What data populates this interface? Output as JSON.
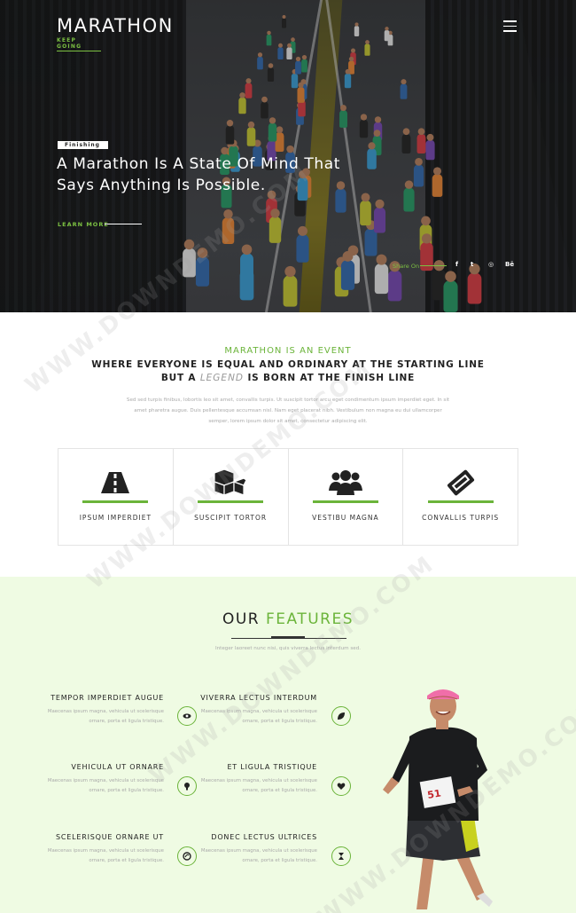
{
  "hero": {
    "brand": "MARATHON",
    "tagline": "KEEP GOING",
    "badge": "Finishing",
    "headline": "A Marathon Is A State Of Mind That Says Anything Is Possible.",
    "learn_more": "LEARN MORE",
    "share_label": "Share On",
    "social": [
      {
        "name": "facebook-icon",
        "glyph": "f"
      },
      {
        "name": "twitter-icon",
        "glyph": "t"
      },
      {
        "name": "dribbble-icon",
        "glyph": "◎"
      },
      {
        "name": "behance-icon",
        "glyph": "Bē"
      }
    ]
  },
  "event": {
    "kicker": "MARATHON IS AN EVENT",
    "title_line1": "WHERE EVERYONE IS EQUAL AND ORDINARY AT THE STARTING LINE",
    "title_line2_pre": "BUT A ",
    "title_line2_em": "LEGEND",
    "title_line2_post": " IS BORN AT THE FINISH LINE",
    "copy": "Sed sed turpis finibus, lobortis leo sit amet, convallis turpis. Ut suscipit tortor arcu eget condimentum ipsum imperdiet eget. In sit amet pharetra augue. Duis pellentesque accumsan nisl. Nam eget placerat nibh. Vestibulum non magna eu dui ullamcorper semper, lorem ipsum dolor sit amet, consectetur adipiscing elit.",
    "cards": [
      {
        "label": "IPSUM IMPERDIET",
        "icon": "road-icon"
      },
      {
        "label": "SUSCIPIT TORTOR",
        "icon": "cubes-icon"
      },
      {
        "label": "VESTIBU MAGNA",
        "icon": "users-icon"
      },
      {
        "label": "CONVALLIS TURPIS",
        "icon": "ticket-icon"
      }
    ]
  },
  "features": {
    "title_plain": "OUR ",
    "title_highlight": "FEATURES",
    "subtitle": "Integer laoreet nunc nisi, quis viverra lectus interdum sed.",
    "items_left": [
      {
        "title": "TEMPOR IMPERDIET AUGUE",
        "desc": "Maecenas ipsum magna, vehicula ut scelerisque ornare, porta et ligula tristique."
      },
      {
        "title": "VEHICULA UT ORNARE",
        "desc": "Maecenas ipsum magna, vehicula ut scelerisque ornare, porta et ligula tristique."
      },
      {
        "title": "SCELERISQUE ORNARE UT",
        "desc": "Maecenas ipsum magna, vehicula ut scelerisque ornare, porta et ligula tristique."
      }
    ],
    "items_right": [
      {
        "title": "VIVERRA LECTUS INTERDUM",
        "desc": "Maecenas ipsum magna, vehicula ut scelerisque ornare, porta et ligula tristique."
      },
      {
        "title": "ET LIGULA TRISTIQUE",
        "desc": "Maecenas ipsum magna, vehicula ut scelerisque ornare, porta et ligula tristique."
      },
      {
        "title": "DONEC LECTUS ULTRICES",
        "desc": "Maecenas ipsum magna, vehicula ut scelerisque ornare, porta et ligula tristique."
      }
    ],
    "icons": [
      "eye-icon",
      "leaf-icon",
      "lightbulb-icon",
      "heart-icon",
      "shield-icon",
      "hourglass-icon"
    ]
  },
  "watermark": "WWW.DOWNDEMO.COM",
  "colors": {
    "accent": "#6bb43a",
    "features_bg": "#effbe3"
  }
}
